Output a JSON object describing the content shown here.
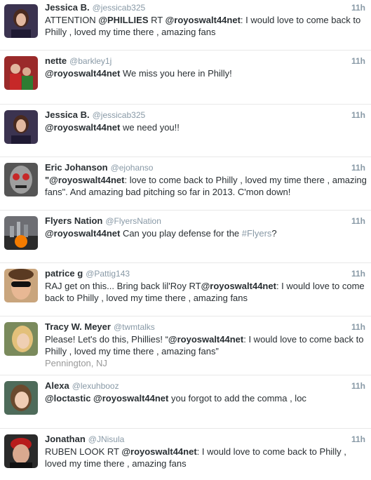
{
  "tweets": [
    {
      "name": "Jessica B.",
      "handle": "@jessicab325",
      "time": "11h",
      "parts": [
        {
          "t": "ATTENTION "
        },
        {
          "t": "@PHILLIES",
          "b": true
        },
        {
          "t": "  RT "
        },
        {
          "t": "@royoswalt44net",
          "b": true
        },
        {
          "t": ": I would love to come back to Philly , loved my time there , amazing fans"
        }
      ],
      "avatar": "avatar-jessica"
    },
    {
      "name": "nette",
      "handle": "@barkley1j",
      "time": "11h",
      "parts": [
        {
          "t": "@royoswalt44net",
          "b": true
        },
        {
          "t": " We miss you here in Philly!"
        }
      ],
      "avatar": "avatar-nette"
    },
    {
      "name": "Jessica B.",
      "handle": "@jessicab325",
      "time": "11h",
      "parts": [
        {
          "t": "@royoswalt44net",
          "b": true
        },
        {
          "t": " we need you!!"
        }
      ],
      "avatar": "avatar-jessica"
    },
    {
      "name": "Eric Johanson",
      "handle": "@ejohanso",
      "time": "11h",
      "parts": [
        {
          "t": "\"@royoswalt44net",
          "b": true
        },
        {
          "t": ": love to come back to Philly , loved my time there , amazing fans\". And amazing bad pitching so far in 2013. C'mon down!"
        }
      ],
      "avatar": "avatar-eric"
    },
    {
      "name": "Flyers Nation",
      "handle": "@FlyersNation",
      "time": "11h",
      "parts": [
        {
          "t": "@royoswalt44net",
          "b": true
        },
        {
          "t": " Can you play defense for the "
        },
        {
          "t": "#Flyers",
          "tag": true
        },
        {
          "t": "?"
        }
      ],
      "avatar": "avatar-flyers"
    },
    {
      "name": "patrice g",
      "handle": "@Pattig143",
      "time": "11h",
      "parts": [
        {
          "t": "RAJ get on this... Bring back lil'Roy RT"
        },
        {
          "t": "@royoswalt44net",
          "b": true
        },
        {
          "t": ": I would love to come back to Philly , loved my time there , amazing fans"
        }
      ],
      "avatar": "avatar-patrice"
    },
    {
      "name": "Tracy W. Meyer",
      "handle": "@twmtalks",
      "time": "11h",
      "parts": [
        {
          "t": "Please! Let's do this, Phillies! “"
        },
        {
          "t": "@royoswalt44net",
          "b": true
        },
        {
          "t": ": I would love to come back to Philly , loved my time there , amazing fans”"
        }
      ],
      "location": "Pennington, NJ",
      "avatar": "avatar-tracy"
    },
    {
      "name": "Alexa",
      "handle": "@lexuhbooz",
      "time": "11h",
      "parts": [
        {
          "t": "@loctastic",
          "b": true
        },
        {
          "t": " "
        },
        {
          "t": "@royoswalt44net",
          "b": true
        },
        {
          "t": " you forgot to add the comma , loc"
        }
      ],
      "avatar": "avatar-alexa"
    },
    {
      "name": "Jonathan",
      "handle": "@JNisula",
      "time": "11h",
      "parts": [
        {
          "t": "RUBEN LOOK RT "
        },
        {
          "t": "@royoswalt44net",
          "b": true
        },
        {
          "t": ": I would love to come back to Philly , loved my time there , amazing fans"
        }
      ],
      "avatar": "avatar-jonathan"
    }
  ]
}
